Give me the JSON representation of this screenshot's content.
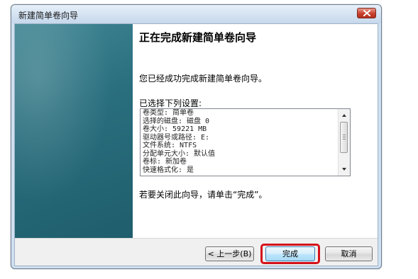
{
  "window": {
    "title": "新建简单卷向导"
  },
  "main": {
    "heading": "正在完成新建简单卷向导",
    "success_text": "您已经成功完成新建简单卷向导。",
    "settings_label": "已选择下列设置:",
    "settings_lines": [
      "卷类型: 简单卷",
      "选择的磁盘: 磁盘 0",
      "卷大小: 59221 MB",
      "驱动器号或路径: E:",
      "文件系统: NTFS",
      "分配单元大小: 默认值",
      "卷标: 新加卷",
      "快速格式化: 是"
    ],
    "close_hint": "若要关闭此向导，请单击“完成”。"
  },
  "buttons": {
    "back": "< 上一步(B)",
    "finish": "完成",
    "cancel": "取消"
  },
  "colors": {
    "side_panel": "#2a6f7e",
    "highlight": "#d4111a",
    "close_button": "#c9402d"
  },
  "icons": {
    "close": "close-icon",
    "scroll_up": "scroll-up-arrow-icon",
    "scroll_down": "scroll-down-arrow-icon"
  }
}
